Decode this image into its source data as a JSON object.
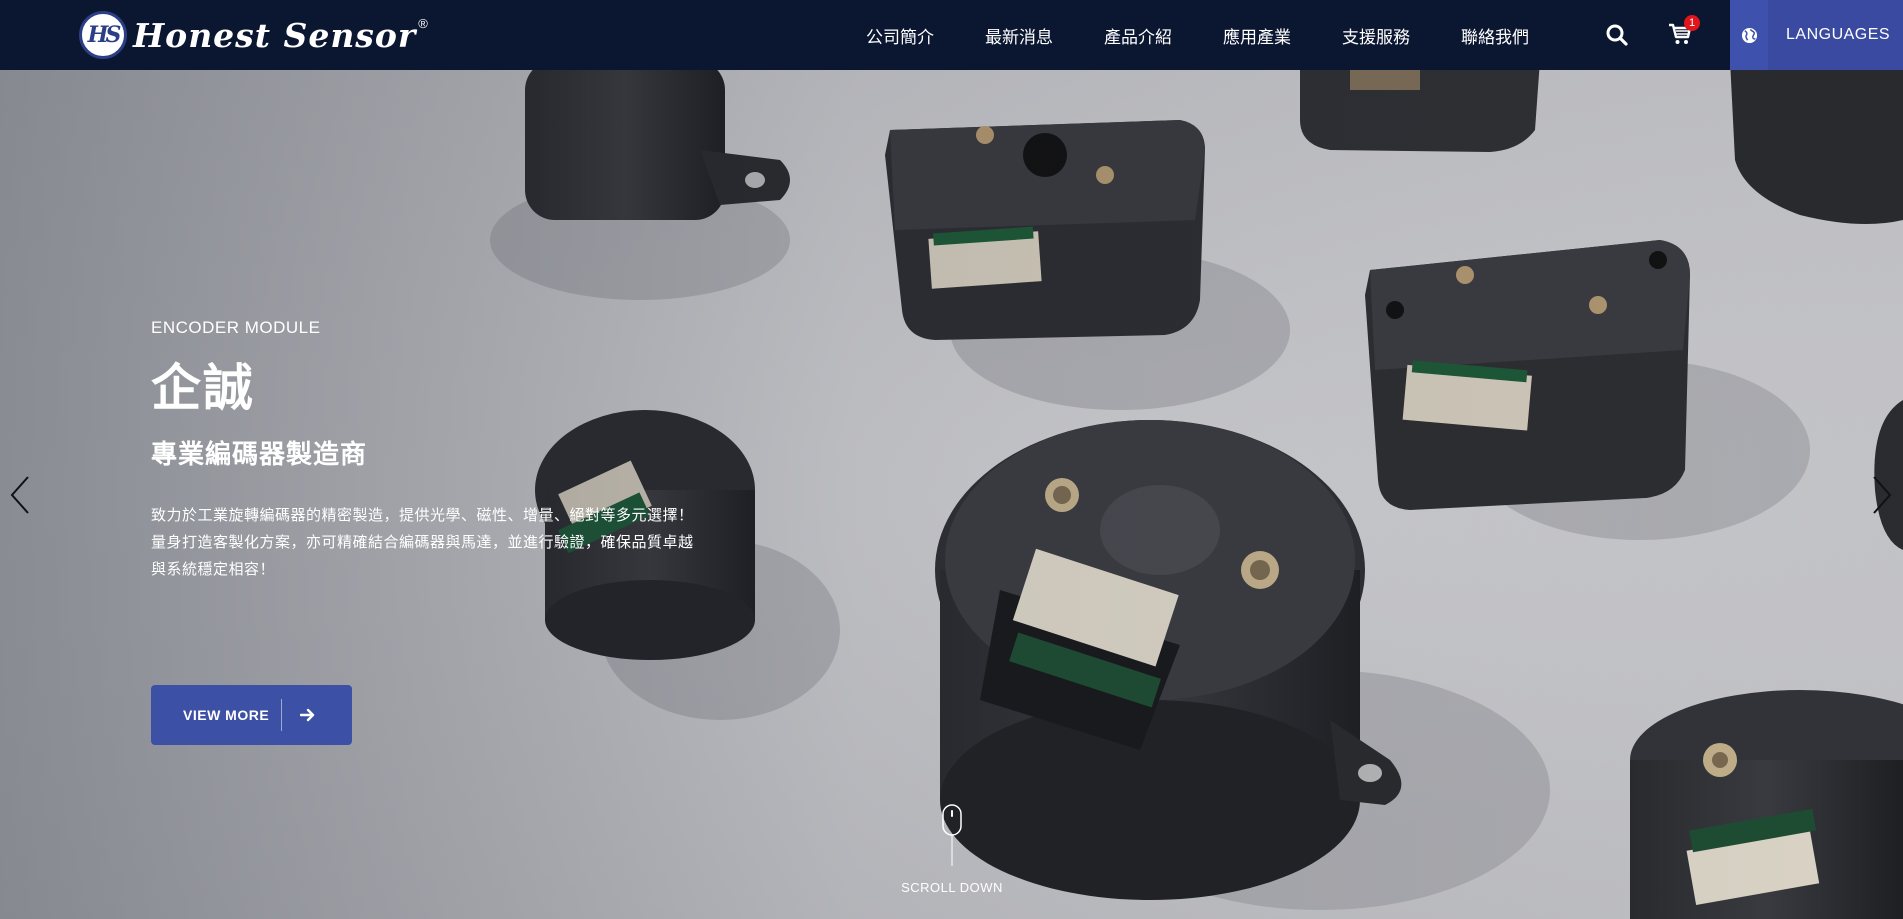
{
  "brand": {
    "logo_text": "Honest Sensor",
    "logo_mark": "HS",
    "registered": "®"
  },
  "nav": {
    "items": [
      {
        "label": "公司簡介"
      },
      {
        "label": "最新消息"
      },
      {
        "label": "產品介紹"
      },
      {
        "label": "應用產業"
      },
      {
        "label": "支援服務"
      },
      {
        "label": "聯絡我們"
      }
    ]
  },
  "header_tools": {
    "search_icon": "search-icon",
    "cart_icon": "cart-icon",
    "cart_count": "1",
    "languages_label": "LANGUAGES",
    "globe_icon": "globe-icon"
  },
  "hero": {
    "eyebrow": "ENCODER MODULE",
    "headline": "企誠",
    "subhead": "專業編碼器製造商",
    "body_lines": [
      "致力於工業旋轉編碼器的精密製造，提供光學、磁性、增量、絕對等多元選擇！",
      "量身打造客製化方案，亦可精確結合編碼器與馬達，並進行驗證，確保品質卓越",
      "與系統穩定相容！"
    ],
    "cta_label": "VIEW MORE",
    "scroll_label": "SCROLL DOWN"
  },
  "colors": {
    "header_bg": "#0b1631",
    "accent": "#3c50a6",
    "badge": "#e0161b"
  }
}
